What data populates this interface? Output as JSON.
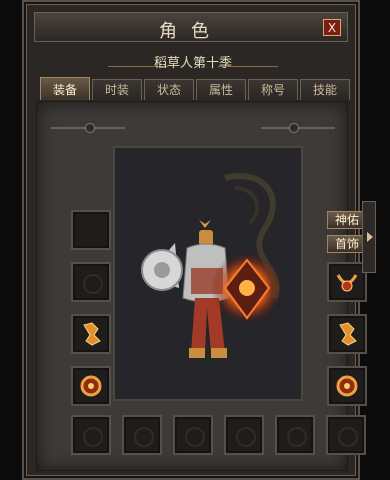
{
  "window": {
    "title": "角色",
    "close_label": "X"
  },
  "character_name": "稻草人第十季",
  "tabs": [
    {
      "label": "装备",
      "active": true
    },
    {
      "label": "时装",
      "active": false
    },
    {
      "label": "状态",
      "active": false
    },
    {
      "label": "属性",
      "active": false
    },
    {
      "label": "称号",
      "active": false
    },
    {
      "label": "技能",
      "active": false
    }
  ],
  "buttons": {
    "blessing_label": "神佑",
    "accessory_label": "首饰"
  },
  "colors": {
    "accent_gold": "#d8a873",
    "flame": "#ff6a1a",
    "close_red": "#7a1f12"
  },
  "equipment_slots": {
    "left": [
      "empty",
      "empty",
      "ring",
      "bracelet"
    ],
    "right": [
      "necklace",
      "ring",
      "bracelet"
    ],
    "bottom": [
      "empty",
      "empty",
      "empty",
      "empty",
      "empty",
      "empty"
    ]
  }
}
